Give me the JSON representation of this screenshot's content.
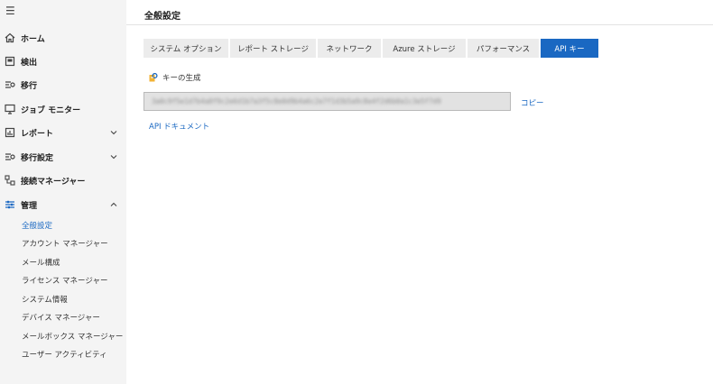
{
  "sidebar": {
    "menu_icon": "☰",
    "items": [
      {
        "label": "ホーム",
        "icon": "home-icon"
      },
      {
        "label": "検出",
        "icon": "detect-icon"
      },
      {
        "label": "移行",
        "icon": "migration-icon"
      },
      {
        "label": "ジョブ モニター",
        "icon": "monitor-icon"
      },
      {
        "label": "レポート",
        "icon": "report-icon",
        "expandable": true
      },
      {
        "label": "移行設定",
        "icon": "migration-settings-icon",
        "expandable": true
      },
      {
        "label": "接続マネージャー",
        "icon": "connection-icon"
      },
      {
        "label": "管理",
        "icon": "admin-icon",
        "expanded": true
      }
    ],
    "sub_items": [
      "全般設定",
      "アカウント マネージャー",
      "メール構成",
      "ライセンス マネージャー",
      "システム情報",
      "デバイス マネージャー",
      "メールボックス マネージャー",
      "ユーザー アクティビティ"
    ],
    "active_sub_item": "全般設定"
  },
  "main": {
    "title": "全般設定",
    "tabs": [
      "システム オプション",
      "レポート ストレージ",
      "ネットワーク",
      "Azure ストレージ",
      "パフォーマンス",
      "API キー"
    ],
    "active_tab": "API キー",
    "generate_key_label": "キーの生成",
    "api_key_value": "3a0c9f5e1d7b4a8f9c2e6d1b7a3f5c8e0d9b4a6c2e7f1d3b5a9c8e4f2d6b0a1c3e5f7d9",
    "copy_label": "コピー",
    "api_docs_label": "API ドキュメント"
  },
  "colors": {
    "accent": "#1a68c2",
    "sidebar_bg": "#f4f4f4",
    "tab_bg": "#ececec"
  }
}
